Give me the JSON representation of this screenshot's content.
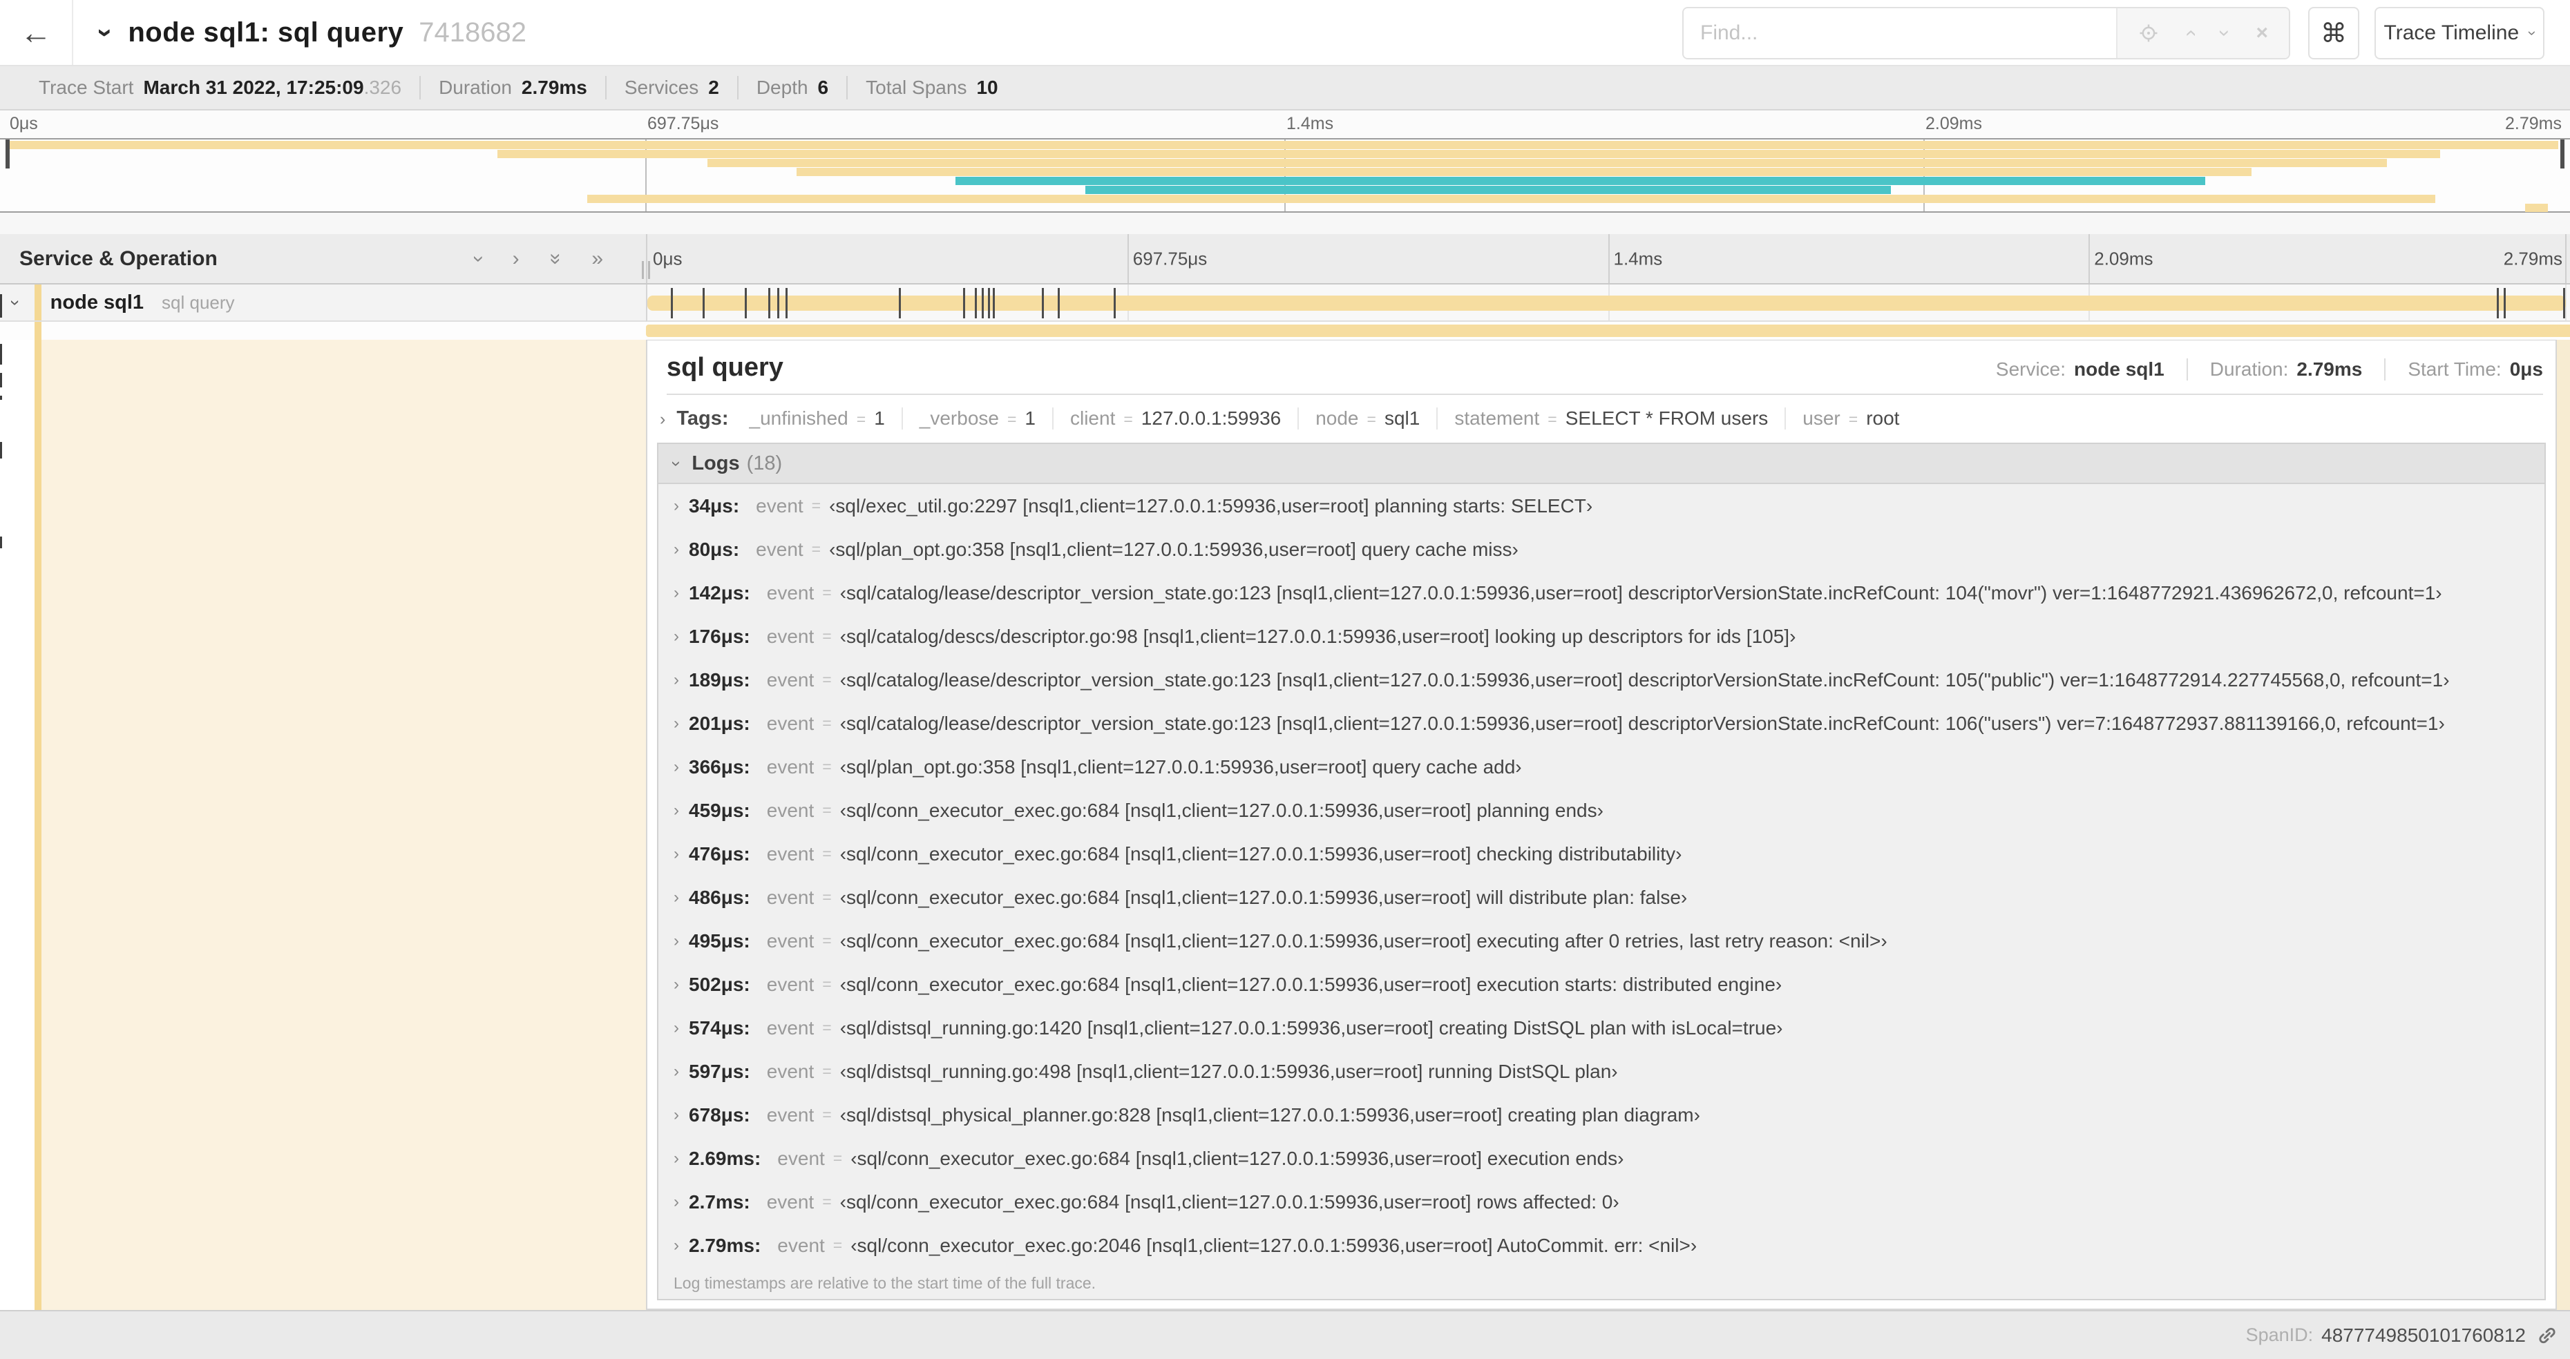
{
  "icons": {
    "back_arrow": "←",
    "chevron": "›",
    "double_chevron": "»",
    "command": "⌘",
    "close": "×",
    "equals": "="
  },
  "header": {
    "title": "node sql1: sql query",
    "trace_id_short": "7418682",
    "find_placeholder": "Find...",
    "view_select_label": "Trace Timeline"
  },
  "summary": {
    "items": [
      {
        "label": "Trace Start",
        "value": "March 31 2022, 17:25:09",
        "suffix": ".326"
      },
      {
        "label": "Duration",
        "value": "2.79ms",
        "suffix": ""
      },
      {
        "label": "Services",
        "value": "2",
        "suffix": ""
      },
      {
        "label": "Depth",
        "value": "6",
        "suffix": ""
      },
      {
        "label": "Total Spans",
        "value": "10",
        "suffix": ""
      }
    ]
  },
  "trace": {
    "total_duration_us": 2790
  },
  "timeline": {
    "axis": [
      "0μs",
      "697.75μs",
      "1.4ms",
      "2.09ms",
      "2.79ms"
    ],
    "columns_header": "Service & Operation"
  },
  "minimap": {
    "bars": [
      {
        "row": 0,
        "s": 0,
        "e": 99.8,
        "color": "tan"
      },
      {
        "row": 1,
        "s": 19.2,
        "e": 95.2,
        "color": "tan"
      },
      {
        "row": 2,
        "s": 27.4,
        "e": 93.1,
        "color": "tan"
      },
      {
        "row": 3,
        "s": 30.9,
        "e": 87.8,
        "color": "tan"
      },
      {
        "row": 4,
        "s": 37.1,
        "e": 86.0,
        "color": "teal"
      },
      {
        "row": 5,
        "s": 42.2,
        "e": 73.7,
        "color": "teal"
      },
      {
        "row": 6,
        "s": 22.7,
        "e": 95.0,
        "color": "tan"
      },
      {
        "row": 7,
        "s": 98.5,
        "e": 99.4,
        "color": "tan"
      }
    ]
  },
  "span_row": {
    "service": "node sql1",
    "operation": "sql query"
  },
  "detail": {
    "title": "sql query",
    "service_label": "Service:",
    "service": "node sql1",
    "duration_label": "Duration:",
    "duration": "2.79ms",
    "start_label": "Start Time:",
    "start": "0μs",
    "tags_label": "Tags:",
    "tags": [
      {
        "k": "_unfinished",
        "v": "1"
      },
      {
        "k": "_verbose",
        "v": "1"
      },
      {
        "k": "client",
        "v": "127.0.0.1:59936"
      },
      {
        "k": "node",
        "v": "sql1"
      },
      {
        "k": "statement",
        "v": "SELECT * FROM users"
      },
      {
        "k": "user",
        "v": "root"
      }
    ],
    "logs_label": "Logs",
    "logs_count": "(18)",
    "logs": [
      {
        "t": "34μs:",
        "us": 34,
        "field": "event",
        "v": "‹sql/exec_util.go:2297 [nsql1,client=127.0.0.1:59936,user=root] planning starts: SELECT›"
      },
      {
        "t": "80μs:",
        "us": 80,
        "field": "event",
        "v": "‹sql/plan_opt.go:358 [nsql1,client=127.0.0.1:59936,user=root] query cache miss›"
      },
      {
        "t": "142μs:",
        "us": 142,
        "field": "event",
        "v": "‹sql/catalog/lease/descriptor_version_state.go:123 [nsql1,client=127.0.0.1:59936,user=root] descriptorVersionState.incRefCount: 104(\"movr\") ver=1:1648772921.436962672,0, refcount=1›"
      },
      {
        "t": "176μs:",
        "us": 176,
        "field": "event",
        "v": "‹sql/catalog/descs/descriptor.go:98 [nsql1,client=127.0.0.1:59936,user=root] looking up descriptors for ids [105]›"
      },
      {
        "t": "189μs:",
        "us": 189,
        "field": "event",
        "v": "‹sql/catalog/lease/descriptor_version_state.go:123 [nsql1,client=127.0.0.1:59936,user=root] descriptorVersionState.incRefCount: 105(\"public\") ver=1:1648772914.227745568,0, refcount=1›"
      },
      {
        "t": "201μs:",
        "us": 201,
        "field": "event",
        "v": "‹sql/catalog/lease/descriptor_version_state.go:123 [nsql1,client=127.0.0.1:59936,user=root] descriptorVersionState.incRefCount: 106(\"users\") ver=7:1648772937.881139166,0, refcount=1›"
      },
      {
        "t": "366μs:",
        "us": 366,
        "field": "event",
        "v": "‹sql/plan_opt.go:358 [nsql1,client=127.0.0.1:59936,user=root] query cache add›"
      },
      {
        "t": "459μs:",
        "us": 459,
        "field": "event",
        "v": "‹sql/conn_executor_exec.go:684 [nsql1,client=127.0.0.1:59936,user=root] planning ends›"
      },
      {
        "t": "476μs:",
        "us": 476,
        "field": "event",
        "v": "‹sql/conn_executor_exec.go:684 [nsql1,client=127.0.0.1:59936,user=root] checking distributability›"
      },
      {
        "t": "486μs:",
        "us": 486,
        "field": "event",
        "v": "‹sql/conn_executor_exec.go:684 [nsql1,client=127.0.0.1:59936,user=root] will distribute plan: false›"
      },
      {
        "t": "495μs:",
        "us": 495,
        "field": "event",
        "v": "‹sql/conn_executor_exec.go:684 [nsql1,client=127.0.0.1:59936,user=root] executing after 0 retries, last retry reason: <nil>›"
      },
      {
        "t": "502μs:",
        "us": 502,
        "field": "event",
        "v": "‹sql/conn_executor_exec.go:684 [nsql1,client=127.0.0.1:59936,user=root] execution starts: distributed engine›"
      },
      {
        "t": "574μs:",
        "us": 574,
        "field": "event",
        "v": "‹sql/distsql_running.go:1420 [nsql1,client=127.0.0.1:59936,user=root] creating DistSQL plan with isLocal=true›"
      },
      {
        "t": "597μs:",
        "us": 597,
        "field": "event",
        "v": "‹sql/distsql_running.go:498 [nsql1,client=127.0.0.1:59936,user=root] running DistSQL plan›"
      },
      {
        "t": "678μs:",
        "us": 678,
        "field": "event",
        "v": "‹sql/distsql_physical_planner.go:828 [nsql1,client=127.0.0.1:59936,user=root] creating plan diagram›"
      },
      {
        "t": "2.69ms:",
        "us": 2690,
        "field": "event",
        "v": "‹sql/conn_executor_exec.go:684 [nsql1,client=127.0.0.1:59936,user=root] execution ends›"
      },
      {
        "t": "2.7ms:",
        "us": 2700,
        "field": "event",
        "v": "‹sql/conn_executor_exec.go:684 [nsql1,client=127.0.0.1:59936,user=root] rows affected: 0›"
      },
      {
        "t": "2.79ms:",
        "us": 2790,
        "field": "event",
        "v": "‹sql/conn_executor_exec.go:2046 [nsql1,client=127.0.0.1:59936,user=root] AutoCommit. err: <nil>›"
      }
    ],
    "logs_footer": "Log timestamps are relative to the start time of the full trace.",
    "spanid_label": "SpanID:",
    "spanid": "4877749850101760812"
  },
  "colors": {
    "tan": "#F6DDA0",
    "teal": "#4AC4C7",
    "accent": "#F4D894",
    "cream": "#FBF2DF"
  }
}
